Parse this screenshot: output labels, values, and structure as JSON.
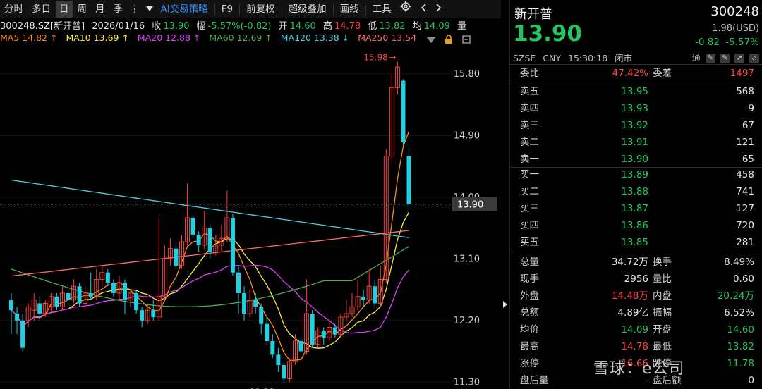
{
  "toolbar": {
    "items": [
      "分时",
      "多日",
      "日",
      "周",
      "月",
      "季",
      "AI交易策略",
      "F9",
      "前复权",
      "超级叠加",
      "画线",
      "工具"
    ],
    "active_index": 2,
    "more_glyph": "⋮",
    "dropdown_icon": "triangle-down-icon",
    "settings_icon": "gear-icon",
    "prev_icon": "chevron-left-icon",
    "next_icon": "chevron-right-icon"
  },
  "info": {
    "code": "300248.SZ[新开普]",
    "date": "2026/01/16",
    "close_label": "收",
    "close": "13.90",
    "amp_label": "幅",
    "amp": "-5.57%(-0.82)",
    "open_label": "开",
    "open": "14.60",
    "high_label": "高",
    "high": "14.78",
    "low_label": "低",
    "low": "13.82",
    "avg_label": "均",
    "avg": "14.09",
    "vol_label": "量"
  },
  "ma": [
    {
      "label": "MA5 14.82 ↑",
      "color": "#ff8c1a"
    },
    {
      "label": "MA10 13.69 ↑",
      "color": "#ffeb3b"
    },
    {
      "label": "MA20 12.88 ↑",
      "color": "#e040fb"
    },
    {
      "label": "MA60 12.69 ↑",
      "color": "#4caf50"
    },
    {
      "label": "MA120 13.38 ↓",
      "color": "#4dd0e1"
    },
    {
      "label": "MA250 13.54",
      "color": "#ff6b6b"
    }
  ],
  "colors": {
    "up": "#ff3b3b",
    "down": "#1fd0e0",
    "ma5": "#ff8c1a",
    "ma10": "#ffeb3b",
    "ma20": "#e040fb",
    "ma60": "#4caf50",
    "ma120": "#4dd0e1",
    "ma250": "#ff6b6b"
  },
  "chart_data": {
    "type": "candlestick",
    "y_ticks": [
      "15.80",
      "14.90",
      "14.00",
      "13.10",
      "12.20",
      "11.30"
    ],
    "ylim": [
      11.2,
      16.2
    ],
    "current_price": "13.90",
    "max_label": "15.98",
    "min_label": "11.28",
    "candles": [
      [
        12.5,
        12.35,
        12.6,
        12.0
      ],
      [
        12.3,
        12.2,
        12.4,
        12.0
      ],
      [
        12.2,
        11.8,
        12.3,
        11.75
      ],
      [
        12.2,
        12.4,
        12.45,
        12.1
      ],
      [
        12.35,
        12.5,
        12.6,
        12.2
      ],
      [
        12.45,
        12.3,
        12.55,
        12.2
      ],
      [
        12.3,
        12.45,
        12.5,
        12.25
      ],
      [
        12.4,
        12.55,
        12.6,
        12.3
      ],
      [
        12.55,
        12.4,
        12.6,
        12.35
      ],
      [
        12.4,
        12.6,
        12.7,
        12.35
      ],
      [
        12.6,
        12.5,
        12.65,
        12.4
      ],
      [
        12.5,
        12.7,
        12.8,
        12.45
      ],
      [
        12.7,
        12.45,
        12.75,
        12.4
      ],
      [
        12.45,
        12.6,
        12.7,
        12.35
      ],
      [
        12.6,
        12.55,
        12.9,
        12.5
      ],
      [
        12.55,
        12.8,
        12.95,
        12.5
      ],
      [
        12.8,
        12.9,
        13.0,
        12.7
      ],
      [
        12.9,
        12.75,
        12.95,
        12.7
      ],
      [
        12.75,
        12.6,
        12.8,
        12.55
      ],
      [
        12.6,
        12.75,
        12.85,
        12.5
      ],
      [
        12.75,
        12.5,
        12.8,
        12.3
      ],
      [
        12.5,
        12.6,
        12.65,
        12.4
      ],
      [
        12.6,
        12.35,
        12.65,
        12.3
      ],
      [
        12.35,
        12.2,
        12.4,
        12.1
      ],
      [
        12.2,
        12.35,
        12.45,
        12.15
      ],
      [
        12.35,
        12.25,
        12.5,
        12.2
      ],
      [
        12.25,
        12.55,
        13.7,
        12.2
      ],
      [
        12.55,
        13.1,
        13.3,
        12.5
      ],
      [
        13.1,
        13.25,
        13.4,
        13.0
      ],
      [
        13.25,
        13.0,
        13.3,
        12.95
      ],
      [
        13.0,
        13.35,
        13.45,
        12.95
      ],
      [
        13.35,
        13.7,
        14.2,
        13.3
      ],
      [
        13.7,
        13.45,
        13.75,
        13.4
      ],
      [
        13.45,
        13.3,
        13.5,
        13.2
      ],
      [
        13.3,
        13.55,
        13.8,
        13.25
      ],
      [
        13.55,
        13.2,
        13.6,
        13.1
      ],
      [
        13.2,
        13.3,
        13.45,
        13.15
      ],
      [
        13.3,
        13.4,
        13.6,
        13.2
      ],
      [
        13.4,
        13.7,
        14.1,
        13.35
      ],
      [
        13.7,
        12.9,
        13.75,
        12.85
      ],
      [
        12.9,
        12.6,
        13.0,
        12.3
      ],
      [
        12.6,
        12.3,
        12.7,
        12.2
      ],
      [
        12.3,
        12.5,
        12.65,
        12.25
      ],
      [
        12.5,
        12.4,
        12.6,
        12.3
      ],
      [
        12.4,
        12.15,
        12.45,
        12.0
      ],
      [
        12.15,
        11.9,
        12.25,
        11.85
      ],
      [
        11.9,
        11.7,
        12.0,
        11.65
      ],
      [
        11.7,
        11.55,
        11.8,
        11.45
      ],
      [
        11.55,
        11.35,
        11.6,
        11.28
      ],
      [
        11.35,
        11.6,
        11.65,
        11.3
      ],
      [
        11.6,
        11.9,
        12.0,
        11.55
      ],
      [
        11.9,
        11.75,
        12.0,
        11.7
      ],
      [
        11.75,
        12.3,
        12.8,
        11.7
      ],
      [
        12.3,
        11.85,
        12.35,
        11.8
      ],
      [
        11.85,
        12.05,
        12.1,
        11.8
      ],
      [
        12.05,
        11.95,
        12.1,
        11.85
      ],
      [
        11.95,
        12.1,
        12.2,
        11.9
      ],
      [
        12.1,
        12.0,
        12.15,
        11.95
      ],
      [
        12.0,
        12.25,
        12.3,
        11.95
      ],
      [
        12.25,
        12.3,
        12.5,
        12.2
      ],
      [
        12.3,
        12.4,
        12.6,
        12.25
      ],
      [
        12.4,
        12.55,
        12.8,
        12.35
      ],
      [
        12.55,
        12.5,
        12.65,
        12.4
      ],
      [
        12.5,
        12.7,
        12.95,
        12.45
      ],
      [
        12.7,
        12.45,
        12.8,
        12.4
      ],
      [
        12.45,
        12.8,
        13.0,
        12.4
      ],
      [
        12.8,
        14.6,
        14.7,
        12.75
      ],
      [
        14.6,
        15.6,
        15.8,
        14.5
      ],
      [
        15.6,
        15.9,
        15.98,
        15.5
      ],
      [
        15.7,
        14.8,
        15.72,
        14.75
      ],
      [
        14.6,
        13.9,
        14.78,
        13.82
      ]
    ]
  },
  "panel": {
    "name": "新开普",
    "code": "300248",
    "price": "13.90",
    "usd": "1.98(USD)",
    "chg": "-0.82",
    "chg_pct": "-5.57%",
    "exchange": "SZSE",
    "currency": "CNY",
    "time": "15:30:18",
    "status": "闭市",
    "tong": "通",
    "weibi_label": "委比",
    "weibi": "47.42%",
    "weicha_label": "委差",
    "weicha": "1497",
    "asks": [
      {
        "label": "卖五",
        "price": "13.95",
        "vol": "568"
      },
      {
        "label": "卖四",
        "price": "13.93",
        "vol": "9"
      },
      {
        "label": "卖三",
        "price": "13.92",
        "vol": "67"
      },
      {
        "label": "卖二",
        "price": "13.91",
        "vol": "121"
      },
      {
        "label": "卖一",
        "price": "13.90",
        "vol": "65"
      }
    ],
    "bids": [
      {
        "label": "买一",
        "price": "13.89",
        "vol": "458"
      },
      {
        "label": "买二",
        "price": "13.88",
        "vol": "741"
      },
      {
        "label": "买三",
        "price": "13.87",
        "vol": "127"
      },
      {
        "label": "买四",
        "price": "13.86",
        "vol": "720"
      },
      {
        "label": "买五",
        "price": "13.85",
        "vol": "281"
      }
    ],
    "stats": [
      {
        "l1": "总量",
        "v1": "34.72万",
        "c1": "w",
        "l2": "换手",
        "v2": "8.49%",
        "c2": "w"
      },
      {
        "l1": "现手",
        "v1": "2956",
        "c1": "w",
        "l2": "量比",
        "v2": "0.60",
        "c2": "w"
      },
      {
        "l1": "外盘",
        "v1": "14.48万",
        "c1": "red",
        "l2": "内盘",
        "v2": "20.24万",
        "c2": "green"
      },
      {
        "l1": "总额",
        "v1": "4.89亿",
        "c1": "w",
        "l2": "振幅",
        "v2": "6.52%",
        "c2": "w"
      },
      {
        "l1": "均价",
        "v1": "14.09",
        "c1": "green",
        "l2": "开盘",
        "v2": "14.60",
        "c2": "green"
      },
      {
        "l1": "最高",
        "v1": "14.78",
        "c1": "red",
        "l2": "最低",
        "v2": "13.82",
        "c2": "green"
      },
      {
        "l1": "涨停",
        "v1": "16.66",
        "c1": "red",
        "l2": "跌停",
        "v2": "11.78",
        "c2": "green"
      },
      {
        "l1": "盘后量",
        "v1": "-",
        "c1": "w",
        "l2": "盘后额",
        "v2": "0",
        "c2": "w"
      }
    ],
    "watermark": "雪球：e公司"
  }
}
